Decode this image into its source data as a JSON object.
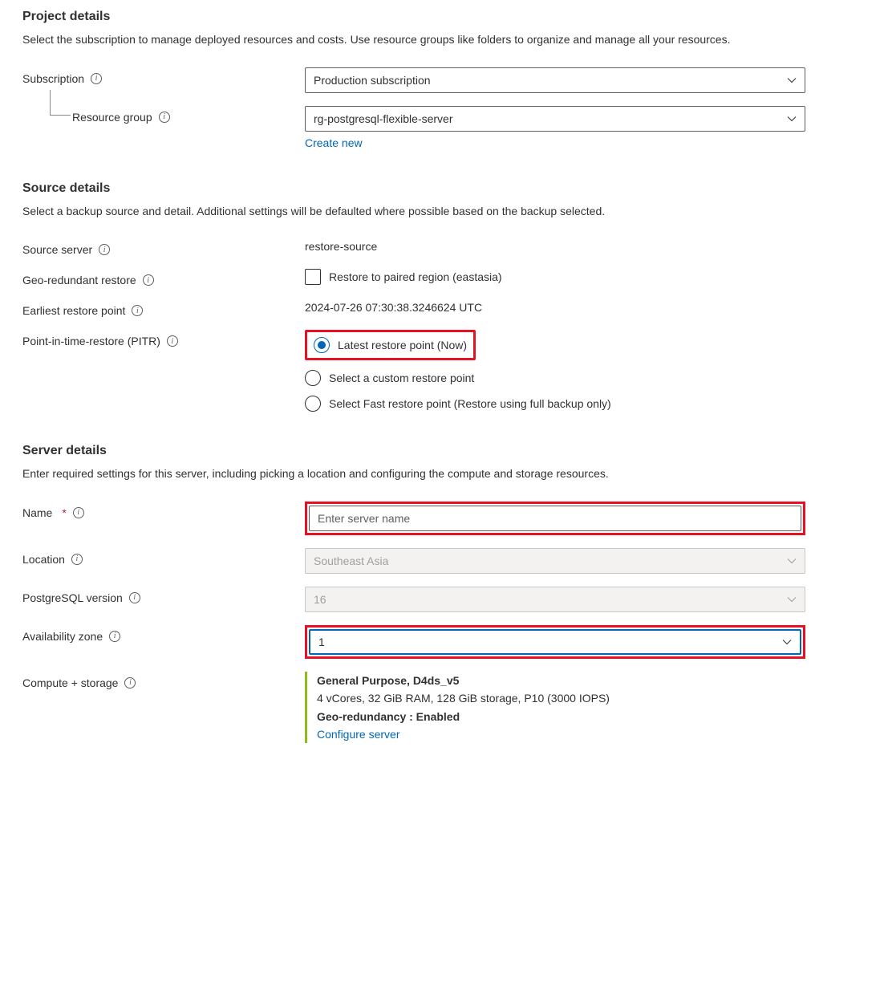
{
  "project": {
    "heading": "Project details",
    "description": "Select the subscription to manage deployed resources and costs. Use resource groups like folders to organize and manage all your resources.",
    "subscription_label": "Subscription",
    "subscription_value": "Production subscription",
    "resource_group_label": "Resource group",
    "resource_group_value": "rg-postgresql-flexible-server",
    "create_new_link": "Create new"
  },
  "source": {
    "heading": "Source details",
    "description": "Select a backup source and detail. Additional settings will be defaulted where possible based on the backup selected.",
    "source_server_label": "Source server",
    "source_server_value": "restore-source",
    "geo_restore_label": "Geo-redundant restore",
    "geo_restore_checkbox_label": "Restore to paired region (eastasia)",
    "earliest_label": "Earliest restore point",
    "earliest_value": "2024-07-26 07:30:38.3246624 UTC",
    "pitr_label": "Point-in-time-restore (PITR)",
    "pitr_options": {
      "latest": "Latest restore point (Now)",
      "custom": "Select a custom restore point",
      "fast": "Select Fast restore point (Restore using full backup only)"
    }
  },
  "server": {
    "heading": "Server details",
    "description": "Enter required settings for this server, including picking a location and configuring the compute and storage resources.",
    "name_label": "Name",
    "name_placeholder": "Enter server name",
    "location_label": "Location",
    "location_value": "Southeast Asia",
    "pg_version_label": "PostgreSQL version",
    "pg_version_value": "16",
    "az_label": "Availability zone",
    "az_value": "1",
    "compute_label": "Compute + storage",
    "compute_title": "General Purpose, D4ds_v5",
    "compute_specs": "4 vCores, 32 GiB RAM, 128 GiB storage, P10 (3000 IOPS)",
    "compute_geo": "Geo-redundancy : Enabled",
    "compute_link": "Configure server"
  }
}
